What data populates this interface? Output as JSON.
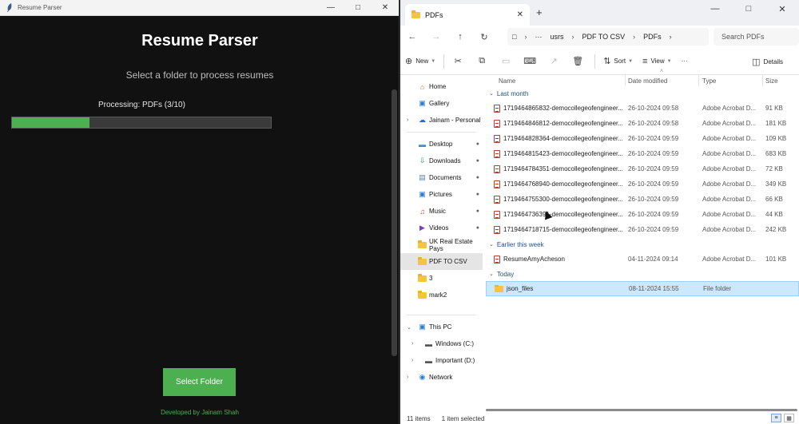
{
  "app": {
    "window_title": "Resume Parser",
    "heading": "Resume Parser",
    "subtitle": "Select a folder to process resumes",
    "status": "Processing: PDFs (3/10)",
    "progress": 0.3,
    "select_button": "Select Folder",
    "credit": "Developed by Jainam Shah",
    "accent_color": "#4caf50"
  },
  "explorer": {
    "tab_title": "PDFs",
    "breadcrumb": [
      "usrs",
      "PDF TO CSV",
      "PDFs"
    ],
    "search_placeholder": "Search PDFs",
    "commands": {
      "new": "New",
      "sort": "Sort",
      "view": "View",
      "more": "···",
      "details": "Details"
    },
    "nav": {
      "home": "Home",
      "gallery": "Gallery",
      "onedrive": "Jainam - Personal",
      "desktop": "Desktop",
      "downloads": "Downloads",
      "documents": "Documents",
      "pictures": "Pictures",
      "music": "Music",
      "videos": "Videos",
      "uk_real_estate": "UK Real Estate Pays",
      "pdf_to_csv": "PDF TO CSV",
      "three": "3",
      "mark2": "mark2",
      "this_pc": "This PC",
      "windows_c": "Windows (C:)",
      "important_d": "Important (D:)",
      "network": "Network"
    },
    "columns": {
      "name": "Name",
      "date": "Date modified",
      "type": "Type",
      "size": "Size"
    },
    "groups": {
      "last_month": "Last month",
      "earlier_this_week": "Earlier this week",
      "today": "Today"
    },
    "last_month_files": [
      {
        "name": "1719464865832-democollegeofengineer...",
        "date": "26-10-2024 09:58",
        "type": "Adobe Acrobat D...",
        "size": "91 KB"
      },
      {
        "name": "1719464846812-democollegeofengineer...",
        "date": "26-10-2024 09:58",
        "type": "Adobe Acrobat D...",
        "size": "181 KB"
      },
      {
        "name": "1719464828364-democollegeofengineer...",
        "date": "26-10-2024 09:59",
        "type": "Adobe Acrobat D...",
        "size": "109 KB"
      },
      {
        "name": "1719464815423-democollegeofengineer...",
        "date": "26-10-2024 09:59",
        "type": "Adobe Acrobat D...",
        "size": "683 KB"
      },
      {
        "name": "1719464784351-democollegeofengineer...",
        "date": "26-10-2024 09:59",
        "type": "Adobe Acrobat D...",
        "size": "72 KB"
      },
      {
        "name": "1719464768940-democollegeofengineer...",
        "date": "26-10-2024 09:59",
        "type": "Adobe Acrobat D...",
        "size": "349 KB"
      },
      {
        "name": "1719464755300-democollegeofengineer...",
        "date": "26-10-2024 09:59",
        "type": "Adobe Acrobat D...",
        "size": "66 KB"
      },
      {
        "name": "1719464736391-democollegeofengineer...",
        "date": "26-10-2024 09:59",
        "type": "Adobe Acrobat D...",
        "size": "44 KB"
      },
      {
        "name": "1719464718715-democollegeofengineer...",
        "date": "26-10-2024 09:59",
        "type": "Adobe Acrobat D...",
        "size": "242 KB"
      }
    ],
    "this_week_files": [
      {
        "name": "ResumeAmyAcheson",
        "date": "04-11-2024 09:14",
        "type": "Adobe Acrobat D...",
        "size": "101 KB"
      }
    ],
    "today_files": [
      {
        "name": "json_files",
        "date": "08-11-2024 15:55",
        "type": "File folder",
        "size": ""
      }
    ],
    "status_items": "11 items",
    "status_selected": "1 item selected"
  }
}
